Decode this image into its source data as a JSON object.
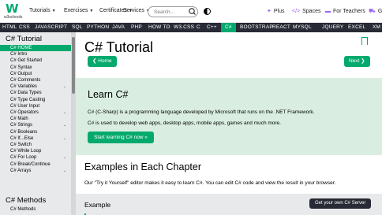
{
  "logo": {
    "mark": "W",
    "text": "w3schools"
  },
  "topnav": [
    {
      "label": "Tutorials"
    },
    {
      "label": "Exercises"
    },
    {
      "label": "Certificates"
    },
    {
      "label": "Services"
    }
  ],
  "search": {
    "placeholder": "Search..."
  },
  "toplinks": [
    {
      "label": "Plus",
      "icon": "plus-icon"
    },
    {
      "label": "Spaces",
      "icon": "spaces-icon"
    },
    {
      "label": "For Teachers",
      "icon": "teachers-icon"
    },
    {
      "label": "Ge",
      "icon": "cart-icon"
    }
  ],
  "langnav": [
    "HTML",
    "CSS",
    "JAVASCRIPT",
    "SQL",
    "PYTHON",
    "JAVA",
    "PHP",
    "HOW TO",
    "W3.CSS",
    "C",
    "C++",
    "C#",
    "BOOTSTRAP",
    "REACT",
    "MYSQL",
    "JQUERY",
    "EXCEL",
    "XM"
  ],
  "sidebar": {
    "heading": "C# Tutorial",
    "items": [
      {
        "label": "C# HOME",
        "active": true
      },
      {
        "label": "C# Intro"
      },
      {
        "label": "C# Get Started"
      },
      {
        "label": "C# Syntax"
      },
      {
        "label": "C# Output"
      },
      {
        "label": "C# Comments"
      },
      {
        "label": "C# Variables",
        "chevron": "⌄"
      },
      {
        "label": "C# Data Types"
      },
      {
        "label": "C# Type Casting"
      },
      {
        "label": "C# User Input"
      },
      {
        "label": "C# Operators",
        "chevron": "⌄"
      },
      {
        "label": "C# Math"
      },
      {
        "label": "C# Strings",
        "chevron": "⌄"
      },
      {
        "label": "C# Booleans"
      },
      {
        "label": "C# If...Else",
        "chevron": "⌄"
      },
      {
        "label": "C# Switch"
      },
      {
        "label": "C# While Loop"
      },
      {
        "label": "C# For Loop",
        "chevron": "⌄"
      },
      {
        "label": "C# Break/Continue"
      },
      {
        "label": "C# Arrays",
        "chevron": "⌄"
      }
    ],
    "heading2": "C# Methods",
    "items2": [
      {
        "label": "C# Methods"
      }
    ]
  },
  "main": {
    "title": "C# Tutorial",
    "prev_label": "❮ Home",
    "next_label": "Next ❯",
    "learn": {
      "heading": "Learn C#",
      "p1": "C# (C-Sharp) is a programming language developed by Microsoft that runs on the .NET Framework.",
      "p2": "C# is used to develop web apps, desktop apps, mobile apps, games and much more.",
      "button": "Start learning C# now »"
    },
    "examples": {
      "heading": "Examples in Each Chapter",
      "text": "Our \"Try it Yourself\" editor makes it easy to learn C#. You can edit C# code and view the result in your browser."
    },
    "example_box": {
      "label": "Example",
      "button": "Get your own C# Server"
    }
  },
  "colors": {
    "accent": "#04aa6d",
    "dark": "#282a35",
    "callout": "#d9eee1",
    "sidebar": "#e7e9eb"
  }
}
